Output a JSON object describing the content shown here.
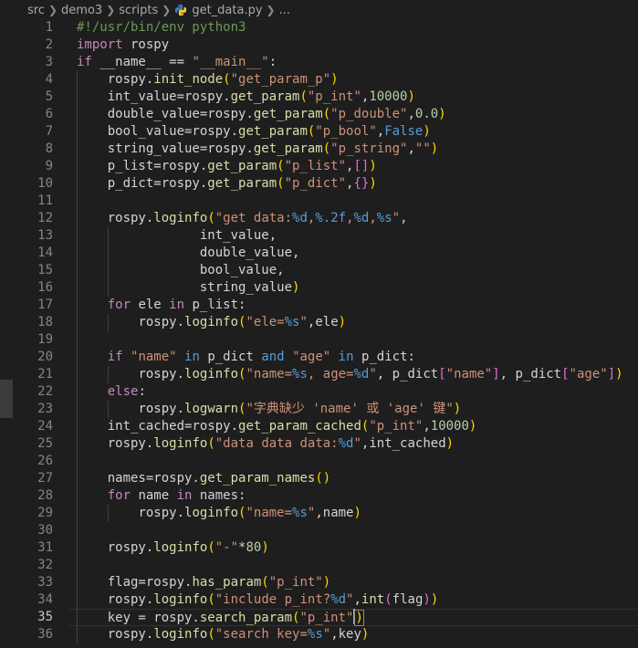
{
  "breadcrumb": {
    "items": [
      "src",
      "demo3",
      "scripts",
      "get_data.py",
      "..."
    ],
    "current_line": 35
  },
  "code": {
    "lines": [
      {
        "n": 1,
        "i": 0,
        "t": [
          [
            "cm",
            "#!/usr/bin/env python3"
          ]
        ]
      },
      {
        "n": 2,
        "i": 0,
        "t": [
          [
            "kw",
            "import"
          ],
          [
            "plain",
            " rospy"
          ]
        ]
      },
      {
        "n": 3,
        "i": 0,
        "t": [
          [
            "kw",
            "if"
          ],
          [
            "plain",
            " __name__ == "
          ],
          [
            "str",
            "\"__main__\""
          ],
          [
            "plain",
            ":"
          ]
        ]
      },
      {
        "n": 4,
        "i": 1,
        "t": [
          [
            "plain",
            "rospy."
          ],
          [
            "fn",
            "init_node"
          ],
          [
            "br1",
            "("
          ],
          [
            "str",
            "\"get_param_p\""
          ],
          [
            "br1",
            ")"
          ]
        ]
      },
      {
        "n": 5,
        "i": 1,
        "t": [
          [
            "plain",
            "int_value=rospy."
          ],
          [
            "fn",
            "get_param"
          ],
          [
            "br1",
            "("
          ],
          [
            "str",
            "\"p_int\""
          ],
          [
            "plain",
            ","
          ],
          [
            "num",
            "10000"
          ],
          [
            "br1",
            ")"
          ]
        ]
      },
      {
        "n": 6,
        "i": 1,
        "t": [
          [
            "plain",
            "double_value=rospy."
          ],
          [
            "fn",
            "get_param"
          ],
          [
            "br1",
            "("
          ],
          [
            "str",
            "\"p_double\""
          ],
          [
            "plain",
            ","
          ],
          [
            "num",
            "0.0"
          ],
          [
            "br1",
            ")"
          ]
        ]
      },
      {
        "n": 7,
        "i": 1,
        "t": [
          [
            "plain",
            "bool_value=rospy."
          ],
          [
            "fn",
            "get_param"
          ],
          [
            "br1",
            "("
          ],
          [
            "str",
            "\"p_bool\""
          ],
          [
            "plain",
            ","
          ],
          [
            "kwb",
            "False"
          ],
          [
            "br1",
            ")"
          ]
        ]
      },
      {
        "n": 8,
        "i": 1,
        "t": [
          [
            "plain",
            "string_value=rospy."
          ],
          [
            "fn",
            "get_param"
          ],
          [
            "br1",
            "("
          ],
          [
            "str",
            "\"p_string\""
          ],
          [
            "plain",
            ","
          ],
          [
            "str",
            "\"\""
          ],
          [
            "br1",
            ")"
          ]
        ]
      },
      {
        "n": 9,
        "i": 1,
        "t": [
          [
            "plain",
            "p_list=rospy."
          ],
          [
            "fn",
            "get_param"
          ],
          [
            "br1",
            "("
          ],
          [
            "str",
            "\"p_list\""
          ],
          [
            "plain",
            ","
          ],
          [
            "br2",
            "[]"
          ],
          [
            "br1",
            ")"
          ]
        ]
      },
      {
        "n": 10,
        "i": 1,
        "t": [
          [
            "plain",
            "p_dict=rospy."
          ],
          [
            "fn",
            "get_param"
          ],
          [
            "br1",
            "("
          ],
          [
            "str",
            "\"p_dict\""
          ],
          [
            "plain",
            ","
          ],
          [
            "br2",
            "{}"
          ],
          [
            "br1",
            ")"
          ]
        ]
      },
      {
        "n": 11,
        "i": 1,
        "t": []
      },
      {
        "n": 12,
        "i": 1,
        "t": [
          [
            "plain",
            "rospy."
          ],
          [
            "fn",
            "loginfo"
          ],
          [
            "br1",
            "("
          ],
          [
            "str",
            "\"get data:"
          ],
          [
            "fmt",
            "%d"
          ],
          [
            "str",
            ","
          ],
          [
            "fmt",
            "%.2f"
          ],
          [
            "str",
            ","
          ],
          [
            "fmt",
            "%d"
          ],
          [
            "str",
            ","
          ],
          [
            "fmt",
            "%s"
          ],
          [
            "str",
            "\""
          ],
          [
            "plain",
            ","
          ]
        ]
      },
      {
        "n": 13,
        "i": 1,
        "g": 4,
        "t": [
          [
            "plain",
            "            int_value,"
          ]
        ]
      },
      {
        "n": 14,
        "i": 1,
        "g": 4,
        "t": [
          [
            "plain",
            "            double_value,"
          ]
        ]
      },
      {
        "n": 15,
        "i": 1,
        "g": 4,
        "t": [
          [
            "plain",
            "            bool_value,"
          ]
        ]
      },
      {
        "n": 16,
        "i": 1,
        "g": 4,
        "t": [
          [
            "plain",
            "            string_value"
          ],
          [
            "br1",
            ")"
          ]
        ]
      },
      {
        "n": 17,
        "i": 1,
        "t": [
          [
            "kw",
            "for"
          ],
          [
            "plain",
            " ele "
          ],
          [
            "kw",
            "in"
          ],
          [
            "plain",
            " p_list:"
          ]
        ]
      },
      {
        "n": 18,
        "i": 2,
        "t": [
          [
            "plain",
            "rospy."
          ],
          [
            "fn",
            "loginfo"
          ],
          [
            "br1",
            "("
          ],
          [
            "str",
            "\"ele="
          ],
          [
            "fmt",
            "%s"
          ],
          [
            "str",
            "\""
          ],
          [
            "plain",
            ",ele"
          ],
          [
            "br1",
            ")"
          ]
        ]
      },
      {
        "n": 19,
        "i": 1,
        "t": []
      },
      {
        "n": 20,
        "i": 1,
        "t": [
          [
            "kw",
            "if"
          ],
          [
            "plain",
            " "
          ],
          [
            "str",
            "\"name\""
          ],
          [
            "plain",
            " "
          ],
          [
            "kwb",
            "in"
          ],
          [
            "plain",
            " p_dict "
          ],
          [
            "kwb",
            "and"
          ],
          [
            "plain",
            " "
          ],
          [
            "str",
            "\"age\""
          ],
          [
            "plain",
            " "
          ],
          [
            "kwb",
            "in"
          ],
          [
            "plain",
            " p_dict:"
          ]
        ]
      },
      {
        "n": 21,
        "i": 2,
        "t": [
          [
            "plain",
            "rospy."
          ],
          [
            "fn",
            "loginfo"
          ],
          [
            "br1",
            "("
          ],
          [
            "str",
            "\"name="
          ],
          [
            "fmt",
            "%s"
          ],
          [
            "str",
            ", age="
          ],
          [
            "fmt",
            "%d"
          ],
          [
            "str",
            "\""
          ],
          [
            "plain",
            ", p_dict"
          ],
          [
            "br2",
            "["
          ],
          [
            "str",
            "\"name\""
          ],
          [
            "br2",
            "]"
          ],
          [
            "plain",
            ", p_dict"
          ],
          [
            "br2",
            "["
          ],
          [
            "str",
            "\"age\""
          ],
          [
            "br2",
            "]"
          ],
          [
            "br1",
            ")"
          ]
        ]
      },
      {
        "n": 22,
        "i": 1,
        "t": [
          [
            "kw",
            "else"
          ],
          [
            "plain",
            ":"
          ]
        ]
      },
      {
        "n": 23,
        "i": 2,
        "t": [
          [
            "plain",
            "rospy."
          ],
          [
            "fn",
            "logwarn"
          ],
          [
            "br1",
            "("
          ],
          [
            "str",
            "\"字典缺少 'name' 或 'age' 键\""
          ],
          [
            "br1",
            ")"
          ]
        ]
      },
      {
        "n": 24,
        "i": 1,
        "t": [
          [
            "plain",
            "int_cached=rospy."
          ],
          [
            "fn",
            "get_param_cached"
          ],
          [
            "br1",
            "("
          ],
          [
            "str",
            "\"p_int\""
          ],
          [
            "plain",
            ","
          ],
          [
            "num",
            "10000"
          ],
          [
            "br1",
            ")"
          ]
        ]
      },
      {
        "n": 25,
        "i": 1,
        "t": [
          [
            "plain",
            "rospy."
          ],
          [
            "fn",
            "loginfo"
          ],
          [
            "br1",
            "("
          ],
          [
            "str",
            "\"data data data:"
          ],
          [
            "fmt",
            "%d"
          ],
          [
            "str",
            "\""
          ],
          [
            "plain",
            ",int_cached"
          ],
          [
            "br1",
            ")"
          ]
        ]
      },
      {
        "n": 26,
        "i": 1,
        "t": []
      },
      {
        "n": 27,
        "i": 1,
        "t": [
          [
            "plain",
            "names=rospy."
          ],
          [
            "fn",
            "get_param_names"
          ],
          [
            "br1",
            "()"
          ]
        ]
      },
      {
        "n": 28,
        "i": 1,
        "t": [
          [
            "kw",
            "for"
          ],
          [
            "plain",
            " name "
          ],
          [
            "kw",
            "in"
          ],
          [
            "plain",
            " names:"
          ]
        ]
      },
      {
        "n": 29,
        "i": 2,
        "t": [
          [
            "plain",
            "rospy."
          ],
          [
            "fn",
            "loginfo"
          ],
          [
            "br1",
            "("
          ],
          [
            "str",
            "\"name="
          ],
          [
            "fmt",
            "%s"
          ],
          [
            "str",
            "\""
          ],
          [
            "plain",
            ",name"
          ],
          [
            "br1",
            ")"
          ]
        ]
      },
      {
        "n": 30,
        "i": 1,
        "t": []
      },
      {
        "n": 31,
        "i": 1,
        "t": [
          [
            "plain",
            "rospy."
          ],
          [
            "fn",
            "loginfo"
          ],
          [
            "br1",
            "("
          ],
          [
            "str",
            "\"-\""
          ],
          [
            "plain",
            "*"
          ],
          [
            "num",
            "80"
          ],
          [
            "br1",
            ")"
          ]
        ]
      },
      {
        "n": 32,
        "i": 1,
        "t": []
      },
      {
        "n": 33,
        "i": 1,
        "t": [
          [
            "plain",
            "flag=rospy."
          ],
          [
            "fn",
            "has_param"
          ],
          [
            "br1",
            "("
          ],
          [
            "str",
            "\"p_int\""
          ],
          [
            "br1",
            ")"
          ]
        ]
      },
      {
        "n": 34,
        "i": 1,
        "t": [
          [
            "plain",
            "rospy."
          ],
          [
            "fn",
            "loginfo"
          ],
          [
            "br1",
            "("
          ],
          [
            "str",
            "\"include p_int?"
          ],
          [
            "fmt",
            "%d"
          ],
          [
            "str",
            "\""
          ],
          [
            "plain",
            ","
          ],
          [
            "fn",
            "int"
          ],
          [
            "br2",
            "("
          ],
          [
            "plain",
            "flag"
          ],
          [
            "br2",
            ")"
          ],
          [
            "br1",
            ")"
          ]
        ]
      },
      {
        "n": 35,
        "i": 1,
        "cur": true,
        "t": [
          [
            "plain",
            "key = rospy."
          ],
          [
            "fn",
            "search_param"
          ],
          [
            "br1",
            "("
          ],
          [
            "str",
            "\"p_int\""
          ],
          [
            "br1",
            ")"
          ]
        ]
      },
      {
        "n": 36,
        "i": 1,
        "t": [
          [
            "plain",
            "rospy."
          ],
          [
            "fn",
            "loginfo"
          ],
          [
            "br1",
            "("
          ],
          [
            "str",
            "\"search key="
          ],
          [
            "fmt",
            "%s"
          ],
          [
            "str",
            "\""
          ],
          [
            "plain",
            ",key"
          ],
          [
            "br1",
            ")"
          ]
        ]
      }
    ]
  }
}
